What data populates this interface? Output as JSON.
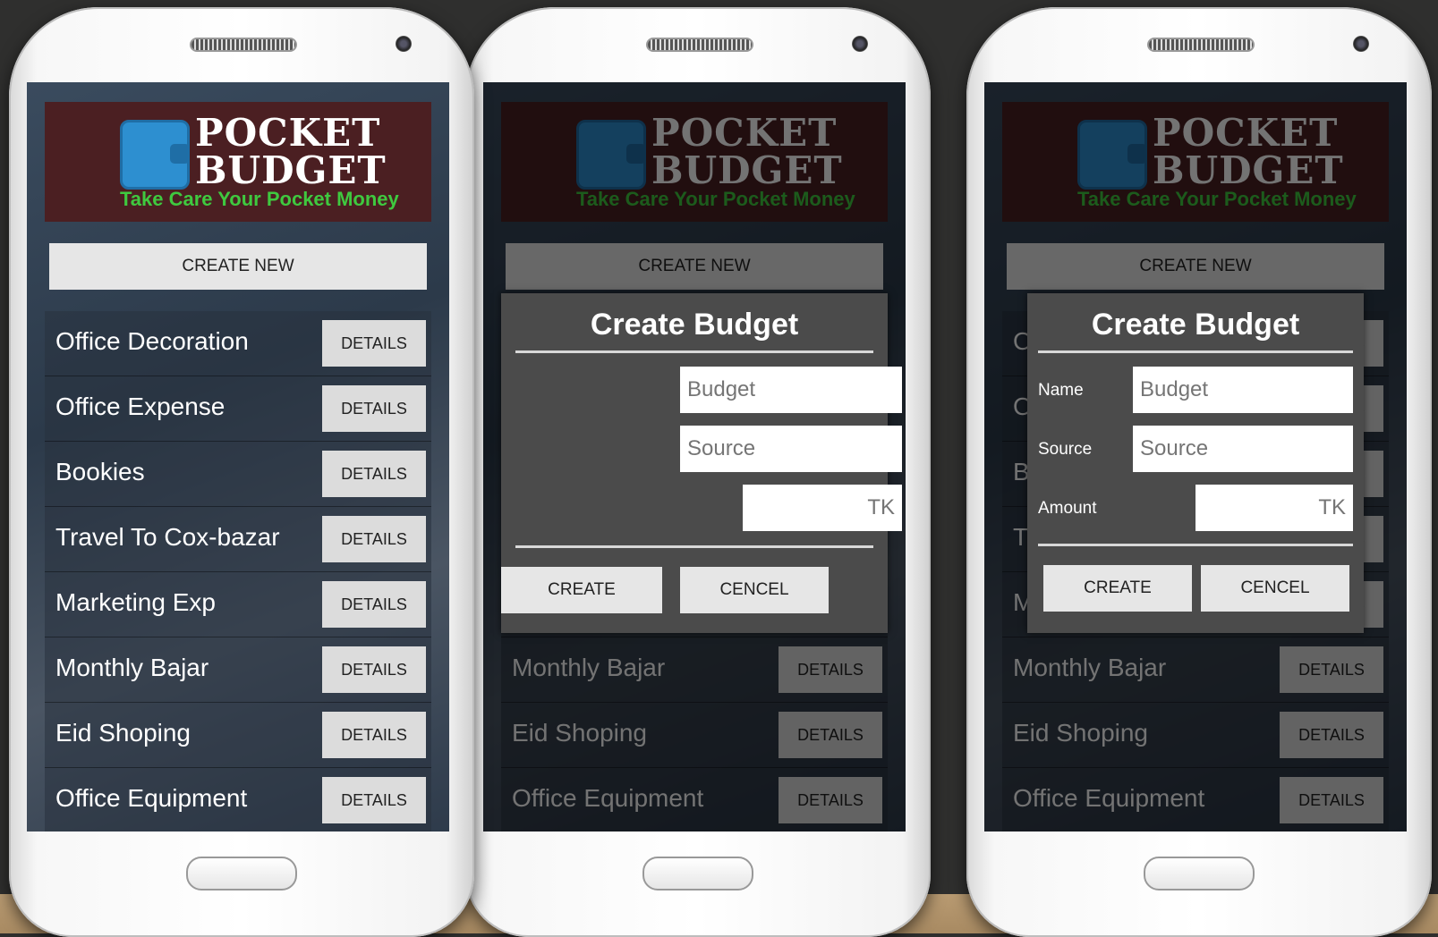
{
  "app": {
    "logo_line1": "POCKET",
    "logo_line2": "BUDGET",
    "tagline": "Take Care Your Pocket Money",
    "create_new_label": "CREATE NEW"
  },
  "list": {
    "details_label": "DETAILS",
    "items": [
      {
        "label": "Office Decoration"
      },
      {
        "label": "Office Expense"
      },
      {
        "label": "Bookies"
      },
      {
        "label": "Travel To Cox-bazar"
      },
      {
        "label": "Marketing Exp"
      },
      {
        "label": "Monthly Bajar"
      },
      {
        "label": "Eid Shoping"
      },
      {
        "label": "Office Equipment"
      }
    ]
  },
  "dialog": {
    "title": "Create Budget",
    "name_label": "Name",
    "source_label": "Source",
    "amount_label": "Amount",
    "name_placeholder": "Budget",
    "source_placeholder": "Source",
    "amount_placeholder": "TK",
    "create_label": "CREATE",
    "cancel_label": "CENCEL"
  },
  "colors": {
    "banner": "#4b1f22",
    "tagline": "#3fc93f",
    "wallet": "#2d8fd0",
    "dialog_bg": "#4b4b4b",
    "button_bg": "#e6e6e6"
  }
}
